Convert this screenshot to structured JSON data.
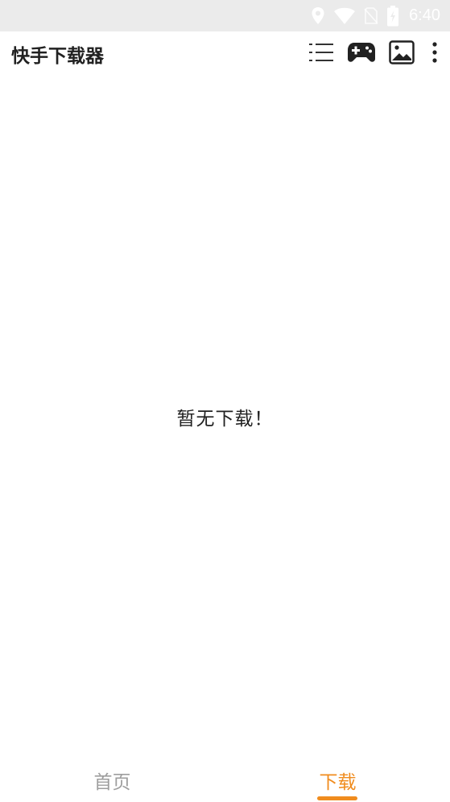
{
  "status_bar": {
    "time": "6:40",
    "icons": [
      "location-icon",
      "wifi-icon",
      "no-sim-icon",
      "battery-charging-icon"
    ]
  },
  "app_bar": {
    "title": "快手下载器",
    "actions": [
      "list-icon",
      "gamepad-icon",
      "image-icon",
      "more-vert-icon"
    ]
  },
  "main": {
    "empty_message": "暂无下载！"
  },
  "bottom_tabs": {
    "items": [
      {
        "label": "首页",
        "selected": false
      },
      {
        "label": "下载",
        "selected": true
      }
    ]
  },
  "colors": {
    "accent": "#f08c1e",
    "inactive_tab": "#9e9e9e",
    "status_bar_bg": "#ebebeb",
    "text_primary": "#212121"
  }
}
